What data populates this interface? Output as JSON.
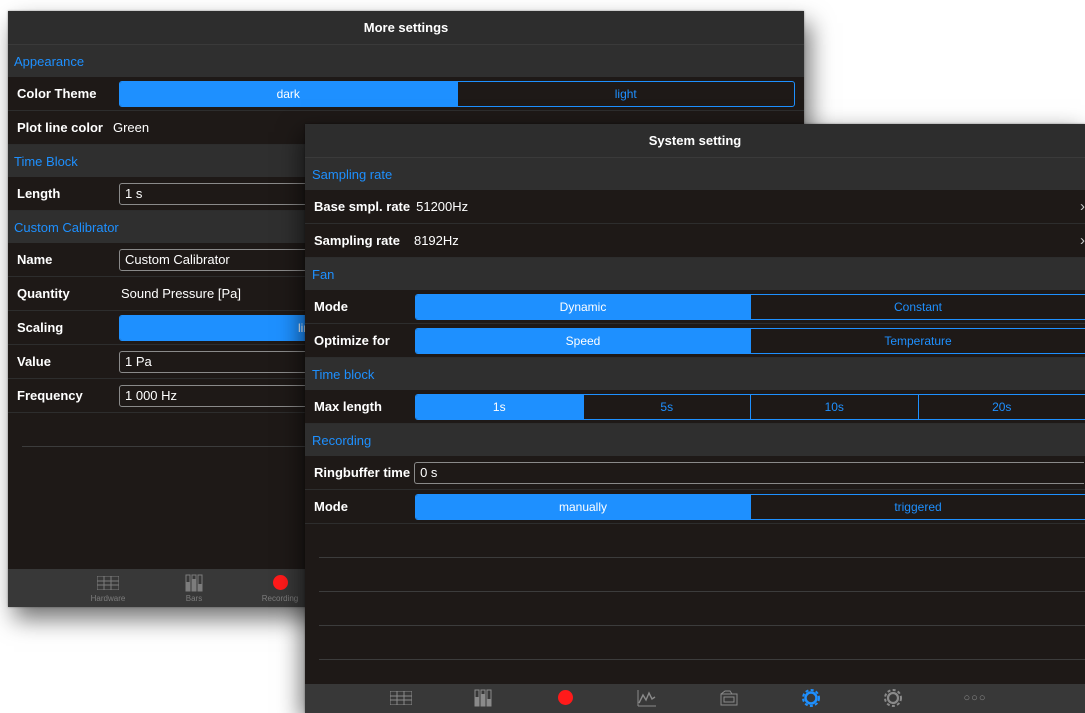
{
  "more_settings": {
    "title": "More settings",
    "appearance": {
      "section": "Appearance",
      "color_theme_label": "Color Theme",
      "color_theme_options": [
        "dark",
        "light"
      ],
      "color_theme_selected": "dark",
      "plot_line_label": "Plot line color",
      "plot_line_value": "Green"
    },
    "time_block": {
      "section": "Time Block",
      "length_label": "Length",
      "length_value": "1 s"
    },
    "custom_calibrator": {
      "section": "Custom Calibrator",
      "name_label": "Name",
      "name_value": "Custom Calibrator",
      "quantity_label": "Quantity",
      "quantity_value": "Sound Pressure [Pa]",
      "scaling_label": "Scaling",
      "scaling_value": "lin",
      "value_label": "Value",
      "value_value": "1 Pa",
      "frequency_label": "Frequency",
      "frequency_value": "1 000 Hz"
    },
    "tabbar": {
      "items": [
        "Hardware",
        "Bars",
        "Recording"
      ]
    }
  },
  "system_setting": {
    "title": "System setting",
    "sampling": {
      "section": "Sampling rate",
      "base_label": "Base smpl. rate",
      "base_value": "51200Hz",
      "rate_label": "Sampling rate",
      "rate_value": "8192Hz"
    },
    "fan": {
      "section": "Fan",
      "mode_label": "Mode",
      "mode_options": [
        "Dynamic",
        "Constant"
      ],
      "mode_selected": "Dynamic",
      "optimize_label": "Optimize for",
      "optimize_options": [
        "Speed",
        "Temperature"
      ],
      "optimize_selected": "Speed"
    },
    "time_block": {
      "section": "Time block",
      "max_label": "Max length",
      "max_options": [
        "1s",
        "5s",
        "10s",
        "20s"
      ],
      "max_selected": "1s"
    },
    "recording": {
      "section": "Recording",
      "ringbuffer_label": "Ringbuffer time",
      "ringbuffer_value": "0 s",
      "mode_label": "Mode",
      "mode_options": [
        "manually",
        "triggered"
      ],
      "mode_selected": "manually"
    },
    "tabbar": {
      "icons": [
        "hardware-icon",
        "bars-icon",
        "recording-icon",
        "analysis-icon",
        "files-icon",
        "settings-icon",
        "gear-icon",
        "more-icon"
      ],
      "active": "settings-icon"
    }
  },
  "colors": {
    "accent": "#1e90ff",
    "background": "#1e1917",
    "record": "#ff1a1a"
  }
}
